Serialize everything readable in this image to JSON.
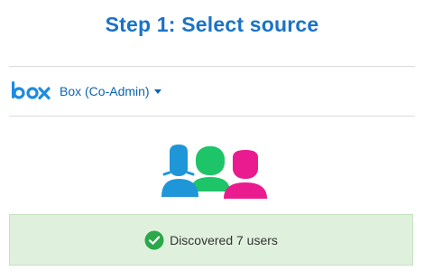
{
  "header": {
    "title": "Step 1: Select source"
  },
  "source": {
    "logo_text": "box",
    "selected": "Box (Co-Admin)",
    "dropdown_icon": "caret-down-icon"
  },
  "illustration": {
    "icon": "users-group-icon",
    "colors": {
      "left_person": "#1e96d8",
      "middle_person": "#1ec468",
      "right_person": "#ea1b8e"
    }
  },
  "status": {
    "icon": "check-circle-icon",
    "text": "Discovered 7 users",
    "colors": {
      "background": "#dff1dd",
      "check": "#2aa84a"
    }
  },
  "colors": {
    "accent": "#1a73c7",
    "link": "#0b63b5"
  }
}
